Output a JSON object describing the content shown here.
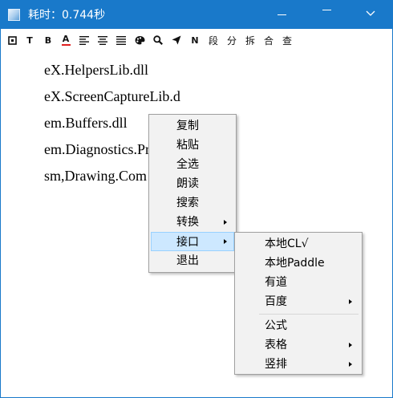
{
  "window": {
    "title": "耗时：0.744秒"
  },
  "toolbar": {
    "text_buttons": {
      "t": "T",
      "b": "B",
      "a": "A",
      "n": "N",
      "duan": "段",
      "fen": "分",
      "chai": "拆",
      "he": "合",
      "cha": "查"
    }
  },
  "editor": {
    "lines": [
      "eX.HelpersLib.dll",
      "eX.ScreenCaptureLib.d",
      "em.Buffers.dll",
      "em.Diagnostics.Pro",
      "sm,Drawing.Com"
    ]
  },
  "context_menu": {
    "items": [
      {
        "label": "复制"
      },
      {
        "label": "粘贴"
      },
      {
        "label": "全选"
      },
      {
        "label": "朗读"
      },
      {
        "label": "搜索"
      },
      {
        "label": "转换"
      },
      {
        "label": "接口"
      },
      {
        "label": "退出"
      }
    ]
  },
  "submenu": {
    "items": [
      {
        "label": "本地CL√"
      },
      {
        "label": "本地Paddle"
      },
      {
        "label": "有道"
      },
      {
        "label": "百度"
      },
      {
        "label": "公式"
      },
      {
        "label": "表格"
      },
      {
        "label": "竖排"
      }
    ]
  },
  "colors": {
    "titlebar": "#1979ca",
    "menu_bg": "#f2f2f2",
    "highlight": "#cde8ff"
  }
}
